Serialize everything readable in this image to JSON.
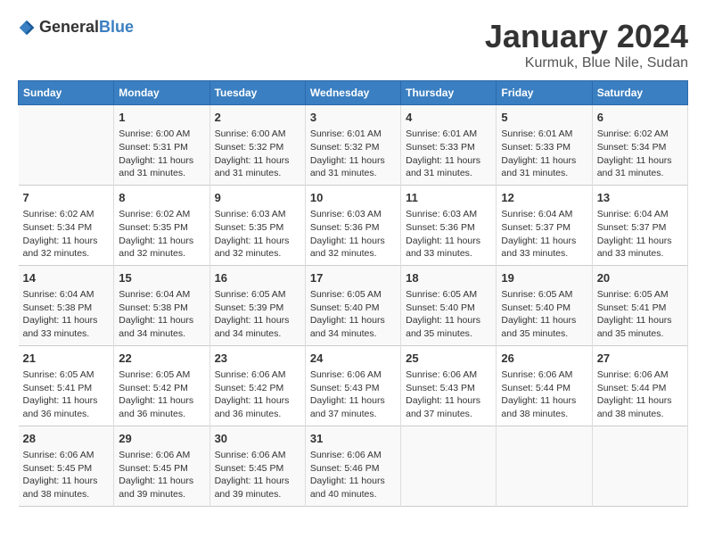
{
  "header": {
    "logo_general": "General",
    "logo_blue": "Blue",
    "month_title": "January 2024",
    "location": "Kurmuk, Blue Nile, Sudan"
  },
  "days_of_week": [
    "Sunday",
    "Monday",
    "Tuesday",
    "Wednesday",
    "Thursday",
    "Friday",
    "Saturday"
  ],
  "weeks": [
    [
      {
        "day": "",
        "info": ""
      },
      {
        "day": "1",
        "info": "Sunrise: 6:00 AM\nSunset: 5:31 PM\nDaylight: 11 hours and 31 minutes."
      },
      {
        "day": "2",
        "info": "Sunrise: 6:00 AM\nSunset: 5:32 PM\nDaylight: 11 hours and 31 minutes."
      },
      {
        "day": "3",
        "info": "Sunrise: 6:01 AM\nSunset: 5:32 PM\nDaylight: 11 hours and 31 minutes."
      },
      {
        "day": "4",
        "info": "Sunrise: 6:01 AM\nSunset: 5:33 PM\nDaylight: 11 hours and 31 minutes."
      },
      {
        "day": "5",
        "info": "Sunrise: 6:01 AM\nSunset: 5:33 PM\nDaylight: 11 hours and 31 minutes."
      },
      {
        "day": "6",
        "info": "Sunrise: 6:02 AM\nSunset: 5:34 PM\nDaylight: 11 hours and 31 minutes."
      }
    ],
    [
      {
        "day": "7",
        "info": "Sunrise: 6:02 AM\nSunset: 5:34 PM\nDaylight: 11 hours and 32 minutes."
      },
      {
        "day": "8",
        "info": "Sunrise: 6:02 AM\nSunset: 5:35 PM\nDaylight: 11 hours and 32 minutes."
      },
      {
        "day": "9",
        "info": "Sunrise: 6:03 AM\nSunset: 5:35 PM\nDaylight: 11 hours and 32 minutes."
      },
      {
        "day": "10",
        "info": "Sunrise: 6:03 AM\nSunset: 5:36 PM\nDaylight: 11 hours and 32 minutes."
      },
      {
        "day": "11",
        "info": "Sunrise: 6:03 AM\nSunset: 5:36 PM\nDaylight: 11 hours and 33 minutes."
      },
      {
        "day": "12",
        "info": "Sunrise: 6:04 AM\nSunset: 5:37 PM\nDaylight: 11 hours and 33 minutes."
      },
      {
        "day": "13",
        "info": "Sunrise: 6:04 AM\nSunset: 5:37 PM\nDaylight: 11 hours and 33 minutes."
      }
    ],
    [
      {
        "day": "14",
        "info": "Sunrise: 6:04 AM\nSunset: 5:38 PM\nDaylight: 11 hours and 33 minutes."
      },
      {
        "day": "15",
        "info": "Sunrise: 6:04 AM\nSunset: 5:38 PM\nDaylight: 11 hours and 34 minutes."
      },
      {
        "day": "16",
        "info": "Sunrise: 6:05 AM\nSunset: 5:39 PM\nDaylight: 11 hours and 34 minutes."
      },
      {
        "day": "17",
        "info": "Sunrise: 6:05 AM\nSunset: 5:40 PM\nDaylight: 11 hours and 34 minutes."
      },
      {
        "day": "18",
        "info": "Sunrise: 6:05 AM\nSunset: 5:40 PM\nDaylight: 11 hours and 35 minutes."
      },
      {
        "day": "19",
        "info": "Sunrise: 6:05 AM\nSunset: 5:40 PM\nDaylight: 11 hours and 35 minutes."
      },
      {
        "day": "20",
        "info": "Sunrise: 6:05 AM\nSunset: 5:41 PM\nDaylight: 11 hours and 35 minutes."
      }
    ],
    [
      {
        "day": "21",
        "info": "Sunrise: 6:05 AM\nSunset: 5:41 PM\nDaylight: 11 hours and 36 minutes."
      },
      {
        "day": "22",
        "info": "Sunrise: 6:05 AM\nSunset: 5:42 PM\nDaylight: 11 hours and 36 minutes."
      },
      {
        "day": "23",
        "info": "Sunrise: 6:06 AM\nSunset: 5:42 PM\nDaylight: 11 hours and 36 minutes."
      },
      {
        "day": "24",
        "info": "Sunrise: 6:06 AM\nSunset: 5:43 PM\nDaylight: 11 hours and 37 minutes."
      },
      {
        "day": "25",
        "info": "Sunrise: 6:06 AM\nSunset: 5:43 PM\nDaylight: 11 hours and 37 minutes."
      },
      {
        "day": "26",
        "info": "Sunrise: 6:06 AM\nSunset: 5:44 PM\nDaylight: 11 hours and 38 minutes."
      },
      {
        "day": "27",
        "info": "Sunrise: 6:06 AM\nSunset: 5:44 PM\nDaylight: 11 hours and 38 minutes."
      }
    ],
    [
      {
        "day": "28",
        "info": "Sunrise: 6:06 AM\nSunset: 5:45 PM\nDaylight: 11 hours and 38 minutes."
      },
      {
        "day": "29",
        "info": "Sunrise: 6:06 AM\nSunset: 5:45 PM\nDaylight: 11 hours and 39 minutes."
      },
      {
        "day": "30",
        "info": "Sunrise: 6:06 AM\nSunset: 5:45 PM\nDaylight: 11 hours and 39 minutes."
      },
      {
        "day": "31",
        "info": "Sunrise: 6:06 AM\nSunset: 5:46 PM\nDaylight: 11 hours and 40 minutes."
      },
      {
        "day": "",
        "info": ""
      },
      {
        "day": "",
        "info": ""
      },
      {
        "day": "",
        "info": ""
      }
    ]
  ]
}
